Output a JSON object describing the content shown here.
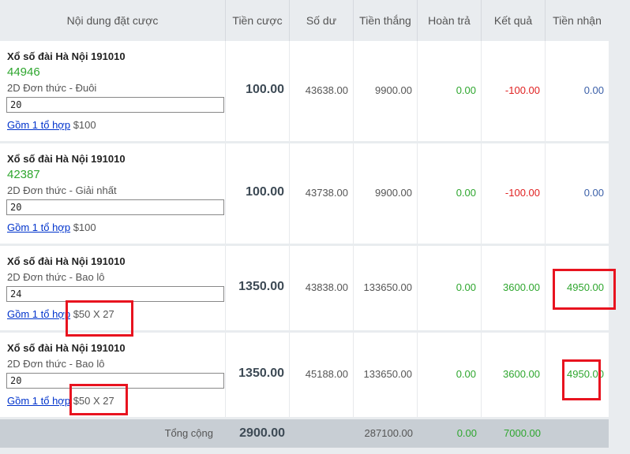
{
  "headers": [
    "Nội dung đặt cược",
    "Tiền cược",
    "Số dư",
    "Tiền thắng",
    "Hoàn trả",
    "Kết quả",
    "Tiền nhận"
  ],
  "rows": [
    {
      "title": "Xổ số đài Hà Nội 191010",
      "number": "44946",
      "type": "2D Đơn thức - Đuôi",
      "input": "20",
      "combo_link": "Gồm 1 tổ hợp",
      "combo_amount": "$100",
      "bet": "100.00",
      "balance": "43638.00",
      "winnings": "9900.00",
      "refund": "0.00",
      "result": "-100.00",
      "received": "0.00"
    },
    {
      "title": "Xổ số đài Hà Nội 191010",
      "number": "42387",
      "type": "2D Đơn thức - Giải nhất",
      "input": "20",
      "combo_link": "Gồm 1 tổ hợp",
      "combo_amount": "$100",
      "bet": "100.00",
      "balance": "43738.00",
      "winnings": "9900.00",
      "refund": "0.00",
      "result": "-100.00",
      "received": "0.00"
    },
    {
      "title": "Xổ số đài Hà Nội 191010",
      "number": "",
      "type": "2D Đơn thức - Bao lô",
      "input": "24",
      "combo_link": "Gồm 1 tổ hợp",
      "combo_amount": "$50 X 27",
      "bet": "1350.00",
      "balance": "43838.00",
      "winnings": "133650.00",
      "refund": "0.00",
      "result": "3600.00",
      "received": "4950.00"
    },
    {
      "title": "Xổ số đài Hà Nội 191010",
      "number": "",
      "type": "2D Đơn thức - Bao lô",
      "input": "20",
      "combo_link": "Gồm 1 tổ hợp",
      "combo_amount": "$50 X 27",
      "bet": "1350.00",
      "balance": "45188.00",
      "winnings": "133650.00",
      "refund": "0.00",
      "result": "3600.00",
      "received": "4950.00"
    }
  ],
  "footer": {
    "label": "Tổng cộng",
    "bet": "2900.00",
    "winnings": "287100.00",
    "refund": "0.00",
    "result": "7000.00"
  },
  "colors": {
    "win": "#2ea62e",
    "loss": "#e02020",
    "neutral": "#3a5fa8",
    "highlight": "#e8131f"
  }
}
